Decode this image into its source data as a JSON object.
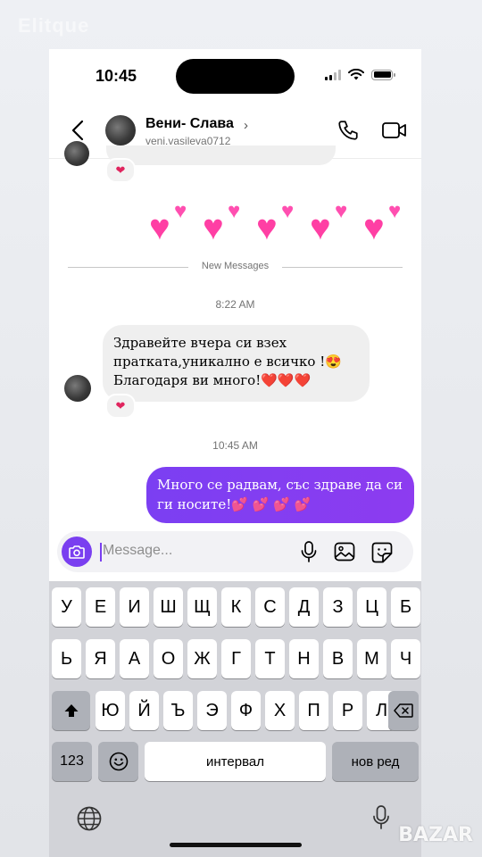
{
  "watermarks": {
    "top_left": "Elitque",
    "bottom_right": "BAZAR"
  },
  "status_bar": {
    "time": "10:45"
  },
  "header": {
    "contact_name": "Вени- Слава",
    "username": "veni.vasileva0712",
    "icons": [
      "back-arrow-icon",
      "chevron-right-icon",
      "phone-icon",
      "video-call-icon"
    ]
  },
  "thread": {
    "previous_reaction": "❤",
    "hearts": [
      "💕",
      "💕",
      "💕",
      "💕",
      "💕"
    ],
    "new_messages_label": "New Messages",
    "timestamp_1": "8:22 AM",
    "incoming_message": "Здравейте вчера си взех\nпратката,уникално е всичко !😍\nБлагодаря ви много!❤️❤️❤️",
    "incoming_reaction": "❤",
    "timestamp_2": "10:45 AM",
    "outgoing_message": "Много  се радвам, със здраве да си ги носите!💕 💕 💕 💕"
  },
  "composer": {
    "placeholder": "Message...",
    "icons": [
      "camera-icon",
      "microphone-icon",
      "gallery-icon",
      "sticker-icon"
    ]
  },
  "keyboard": {
    "row1": [
      "У",
      "Е",
      "И",
      "Ш",
      "Щ",
      "К",
      "С",
      "Д",
      "З",
      "Ц",
      "Б"
    ],
    "row2": [
      "Ь",
      "Я",
      "А",
      "О",
      "Ж",
      "Г",
      "Т",
      "Н",
      "В",
      "М",
      "Ч"
    ],
    "row3": [
      "Ю",
      "Й",
      "Ъ",
      "Э",
      "Ф",
      "Х",
      "П",
      "Р",
      "Л"
    ],
    "numbers_key": "123",
    "space_key": "интервал",
    "return_key": "нов ред",
    "icons": [
      "shift-icon",
      "backspace-icon",
      "emoji-icon",
      "globe-icon",
      "dictation-mic-icon"
    ]
  },
  "colors": {
    "accent": "#7b3ff2",
    "heart": "#ff3fa4",
    "reaction": "#e0245e"
  }
}
